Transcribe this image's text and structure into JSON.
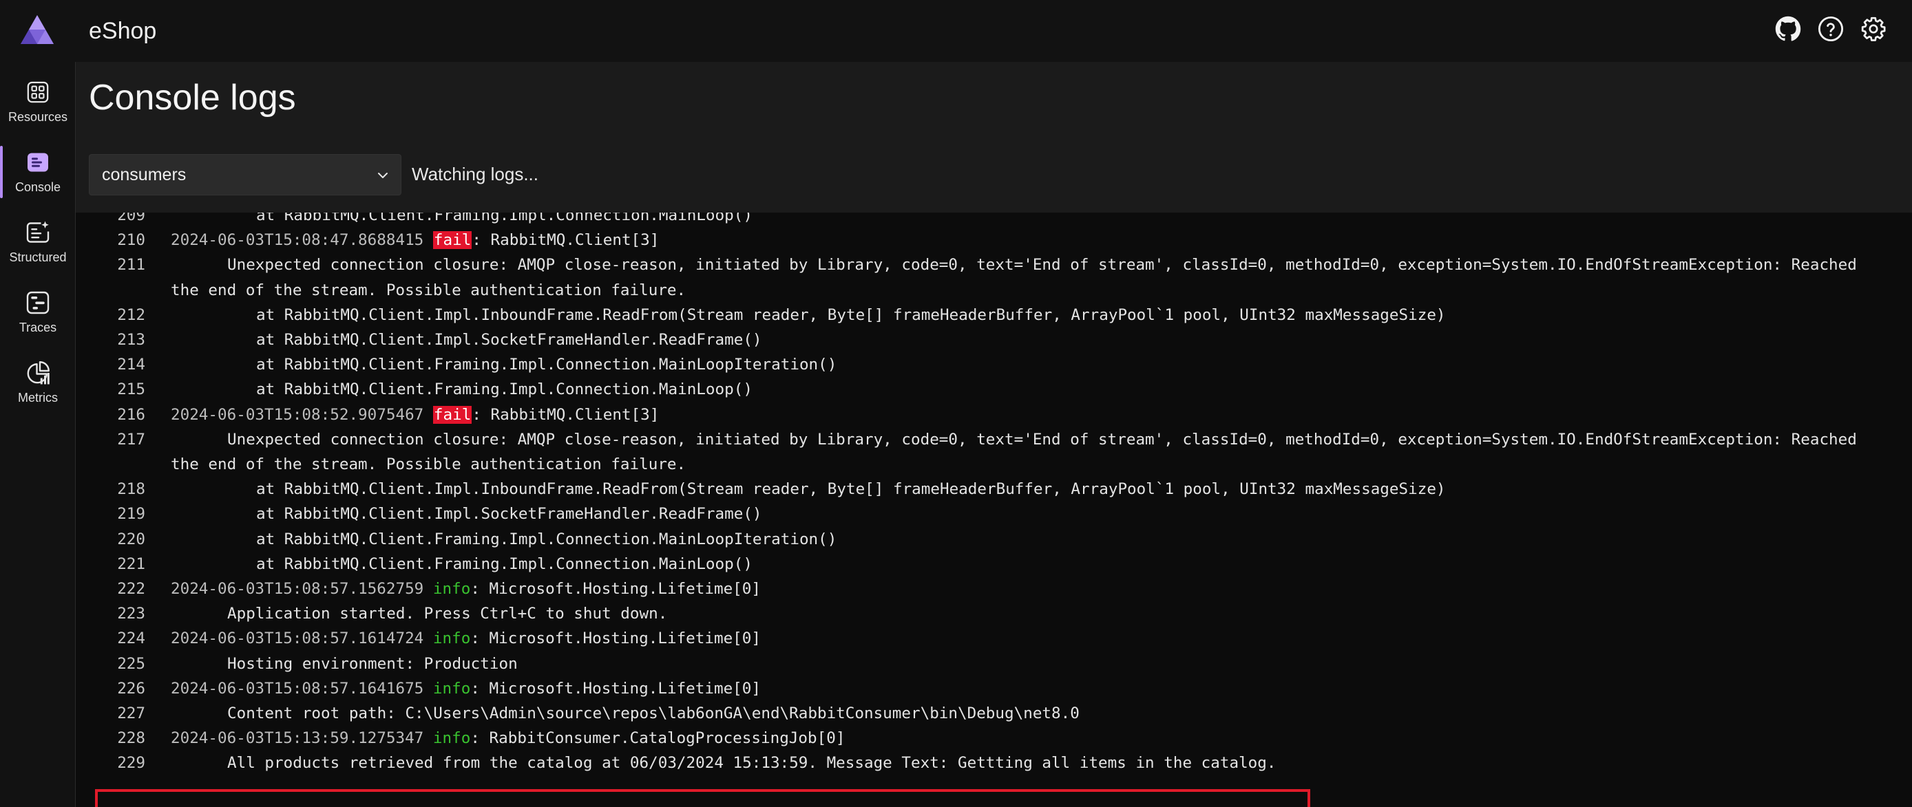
{
  "app": {
    "title": "eShop"
  },
  "top_icons": [
    {
      "name": "github-icon"
    },
    {
      "name": "help-icon"
    },
    {
      "name": "gear-icon"
    }
  ],
  "sidebar": {
    "items": [
      {
        "label": "Resources",
        "icon": "resources-icon"
      },
      {
        "label": "Console",
        "icon": "console-icon",
        "active": true
      },
      {
        "label": "Structured",
        "icon": "structured-icon"
      },
      {
        "label": "Traces",
        "icon": "traces-icon"
      },
      {
        "label": "Metrics",
        "icon": "metrics-icon"
      }
    ]
  },
  "page": {
    "title": "Console logs",
    "resource_select": "consumers",
    "status": "Watching logs..."
  },
  "colors": {
    "accent": "#b38bf5",
    "fail_badge": "#e3142c",
    "info_text": "#39c22f",
    "highlight_border": "#e01b2a"
  },
  "logs": [
    {
      "n": "209",
      "text": "at RabbitMQ.Client.Framing.Impl.Connection.MainLoop()"
    },
    {
      "n": "210",
      "ts": "2024-06-03T15:08:47.8688415",
      "level": "fail",
      "text": ": RabbitMQ.Client[3]"
    },
    {
      "n": "211",
      "text": "Unexpected connection closure: AMQP close-reason, initiated by Library, code=0, text='End of stream', classId=0, methodId=0, exception=System.IO.EndOfStreamException: Reached"
    },
    {
      "n": "",
      "text": "the end of the stream. Possible authentication failure."
    },
    {
      "n": "212",
      "text": "at RabbitMQ.Client.Impl.InboundFrame.ReadFrom(Stream reader, Byte[] frameHeaderBuffer, ArrayPool`1 pool, UInt32 maxMessageSize)"
    },
    {
      "n": "213",
      "text": "at RabbitMQ.Client.Impl.SocketFrameHandler.ReadFrame()"
    },
    {
      "n": "214",
      "text": "at RabbitMQ.Client.Framing.Impl.Connection.MainLoopIteration()"
    },
    {
      "n": "215",
      "text": "at RabbitMQ.Client.Framing.Impl.Connection.MainLoop()"
    },
    {
      "n": "216",
      "ts": "2024-06-03T15:08:52.9075467",
      "level": "fail",
      "text": ": RabbitMQ.Client[3]"
    },
    {
      "n": "217",
      "text": "Unexpected connection closure: AMQP close-reason, initiated by Library, code=0, text='End of stream', classId=0, methodId=0, exception=System.IO.EndOfStreamException: Reached"
    },
    {
      "n": "",
      "text": "the end of the stream. Possible authentication failure."
    },
    {
      "n": "218",
      "text": "at RabbitMQ.Client.Impl.InboundFrame.ReadFrom(Stream reader, Byte[] frameHeaderBuffer, ArrayPool`1 pool, UInt32 maxMessageSize)"
    },
    {
      "n": "219",
      "text": "at RabbitMQ.Client.Impl.SocketFrameHandler.ReadFrame()"
    },
    {
      "n": "220",
      "text": "at RabbitMQ.Client.Framing.Impl.Connection.MainLoopIteration()"
    },
    {
      "n": "221",
      "text": "at RabbitMQ.Client.Framing.Impl.Connection.MainLoop()"
    },
    {
      "n": "222",
      "ts": "2024-06-03T15:08:57.1562759",
      "level": "info",
      "text": ": Microsoft.Hosting.Lifetime[0]"
    },
    {
      "n": "223",
      "text": "Application started. Press Ctrl+C to shut down."
    },
    {
      "n": "224",
      "ts": "2024-06-03T15:08:57.1614724",
      "level": "info",
      "text": ": Microsoft.Hosting.Lifetime[0]"
    },
    {
      "n": "225",
      "text": "Hosting environment: Production"
    },
    {
      "n": "226",
      "ts": "2024-06-03T15:08:57.1641675",
      "level": "info",
      "text": ": Microsoft.Hosting.Lifetime[0]"
    },
    {
      "n": "227",
      "text": "Content root path: C:\\Users\\Admin\\source\\repos\\lab6onGA\\end\\RabbitConsumer\\bin\\Debug\\net8.0"
    },
    {
      "n": "228",
      "ts": "2024-06-03T15:13:59.1275347",
      "level": "info",
      "text": ": RabbitConsumer.CatalogProcessingJob[0]"
    },
    {
      "n": "229",
      "text": "All products retrieved from the catalog at 06/03/2024 15:13:59. Message Text: Gettting all items in the catalog."
    }
  ]
}
